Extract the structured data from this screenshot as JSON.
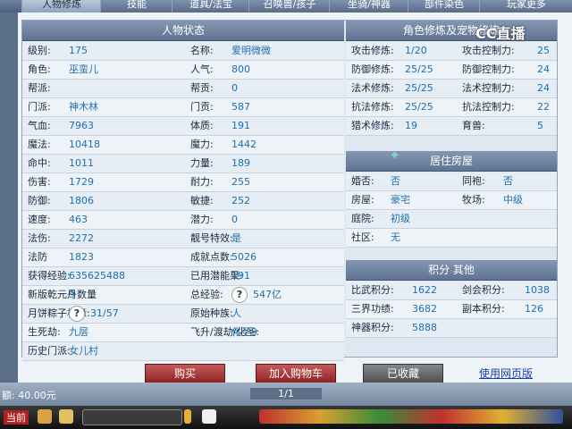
{
  "tabs": [
    "人物修炼",
    "技能",
    "道具/法宝",
    "召唤兽/孩子",
    "坐骑/神器",
    "部件染色",
    "玩家更多"
  ],
  "left_header": "人物状态",
  "right_header": "角色修炼及宠物修炼",
  "house_header": "居住房屋",
  "score_header": "积分 其他",
  "left_rows": [
    {
      "l1": "级别:",
      "v1": "175",
      "l2": "名称:",
      "v2": "爱明微微"
    },
    {
      "l1": "角色:",
      "v1": "巫蛮儿",
      "l2": "人气:",
      "v2": "800"
    },
    {
      "l1": "帮派:",
      "v1": "",
      "l2": "帮贡:",
      "v2": "0"
    },
    {
      "l1": "门派:",
      "v1": "神木林",
      "l2": "门贡:",
      "v2": "587"
    },
    {
      "l1": "气血:",
      "v1": "7963",
      "l2": "体质:",
      "v2": "191"
    },
    {
      "l1": "魔法:",
      "v1": "10418",
      "l2": "魔力:",
      "v2": "1442"
    },
    {
      "l1": "命中:",
      "v1": "1011",
      "l2": "力量:",
      "v2": "189"
    },
    {
      "l1": "伤害:",
      "v1": "1729",
      "l2": "耐力:",
      "v2": "255"
    },
    {
      "l1": "防御:",
      "v1": "1806",
      "l2": "敏捷:",
      "v2": "252"
    },
    {
      "l1": "速度:",
      "v1": "463",
      "l2": "潜力:",
      "v2": "0"
    },
    {
      "l1": "法伤:",
      "v1": "2272",
      "l2": "靓号特效:",
      "v2": "是"
    },
    {
      "l1": "法防",
      "v1": "1823",
      "l2": "成就点数:",
      "v2": "5026"
    },
    {
      "l1": "获得经验:",
      "v1": "635625488",
      "l2": "已用潜能果:",
      "v2": "191"
    },
    {
      "l1": "新版乾元丹数量",
      "v1": "9",
      "l2": "总经验:",
      "v2": "547亿"
    },
    {
      "l1": "月饼粽子机缘:",
      "v1": "31/57",
      "l2": "原始种族:",
      "v2": "人"
    },
    {
      "l1": "生死劫:",
      "v1": "九层",
      "l2": "飞升/渡劫/化圣:",
      "v2": "化圣9"
    },
    {
      "l1": "历史门派:",
      "v1": "女儿村",
      "l2": "",
      "v2": ""
    }
  ],
  "cultivation_rows": [
    {
      "l1": "攻击修炼:",
      "v1": "1/20",
      "l2": "攻击控制力:",
      "v2": "25"
    },
    {
      "l1": "防御修炼:",
      "v1": "25/25",
      "l2": "防御控制力:",
      "v2": "24"
    },
    {
      "l1": "法术修炼:",
      "v1": "25/25",
      "l2": "法术控制力:",
      "v2": "24"
    },
    {
      "l1": "抗法修炼:",
      "v1": "25/25",
      "l2": "抗法控制力:",
      "v2": "22"
    },
    {
      "l1": "猎术修炼:",
      "v1": "19",
      "l2": "育兽:",
      "v2": "5"
    }
  ],
  "house_rows": [
    {
      "l1": "婚否:",
      "v1": "否",
      "l2": "同袍:",
      "v2": "否"
    },
    {
      "l1": "房屋:",
      "v1": "豪宅",
      "l2": "牧场:",
      "v2": "中级"
    },
    {
      "l1": "庭院:",
      "v1": "初级",
      "l2": "",
      "v2": ""
    },
    {
      "l1": "社区:",
      "v1": "无",
      "l2": "",
      "v2": ""
    }
  ],
  "score_rows": [
    {
      "l1": "比武积分:",
      "v1": "1622",
      "l2": "剑会积分:",
      "v2": "1038"
    },
    {
      "l1": "三界功绩:",
      "v1": "3682",
      "l2": "副本积分:",
      "v2": "126"
    },
    {
      "l1": "神器积分:",
      "v1": "5888",
      "l2": "",
      "v2": ""
    }
  ],
  "buttons": {
    "buy": "购买",
    "cart": "加入购物车",
    "saved": "已收藏",
    "web": "使用网页版"
  },
  "question_mark": "?",
  "logo_text": "CC直播",
  "bottom_left": "额: 40.00元",
  "pager": "1/1",
  "taskbar_label": "当前",
  "colors": {
    "accent": "#1d6fae",
    "header": "#6f829f",
    "button_red": "#a33a3a"
  }
}
